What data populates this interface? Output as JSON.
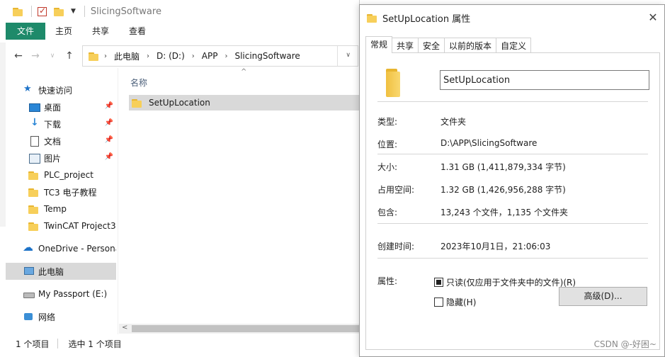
{
  "explorer": {
    "title": "SlicingSoftware",
    "ribbon_tabs": [
      "文件",
      "主页",
      "共享",
      "查看"
    ],
    "address": {
      "crumbs": [
        "此电脑",
        "D: (D:)",
        "APP",
        "SlicingSoftware"
      ]
    },
    "nav": {
      "quick_access": "快速访问",
      "pinned": [
        {
          "label": "桌面",
          "icon": "desktop-icon"
        },
        {
          "label": "下载",
          "icon": "download-icon"
        },
        {
          "label": "文档",
          "icon": "document-icon"
        },
        {
          "label": "图片",
          "icon": "picture-icon"
        }
      ],
      "folders": [
        "PLC_project",
        "TC3 电子教程",
        "Temp",
        "TwinCAT Project3"
      ],
      "onedrive": "OneDrive - Persona",
      "this_pc": "此电脑",
      "passport": "My Passport (E:)",
      "network": "网络"
    },
    "list": {
      "column_name": "名称",
      "files": [
        "SetUpLocation"
      ]
    },
    "status": {
      "items": "1 个项目",
      "selected": "选中 1 个项目"
    }
  },
  "props": {
    "title": "SetUpLocation 属性",
    "tabs": [
      "常规",
      "共享",
      "安全",
      "以前的版本",
      "自定义"
    ],
    "name_value": "SetUpLocation",
    "type_label": "类型:",
    "type_value": "文件夹",
    "location_label": "位置:",
    "location_value": "D:\\APP\\SlicingSoftware",
    "size_label": "大小:",
    "size_value": "1.31 GB (1,411,879,334 字节)",
    "disk_label": "占用空间:",
    "disk_value": "1.32 GB (1,426,956,288 字节)",
    "contains_label": "包含:",
    "contains_value": "13,243 个文件，1,135 个文件夹",
    "created_label": "创建时间:",
    "created_value": "2023年10月1日，21:06:03",
    "attr_label": "属性:",
    "readonly_label": "只读(仅应用于文件夹中的文件)(R)",
    "hidden_label": "隐藏(H)",
    "advanced_button": "高级(D)..."
  },
  "watermark": "CSDN @-好困~"
}
